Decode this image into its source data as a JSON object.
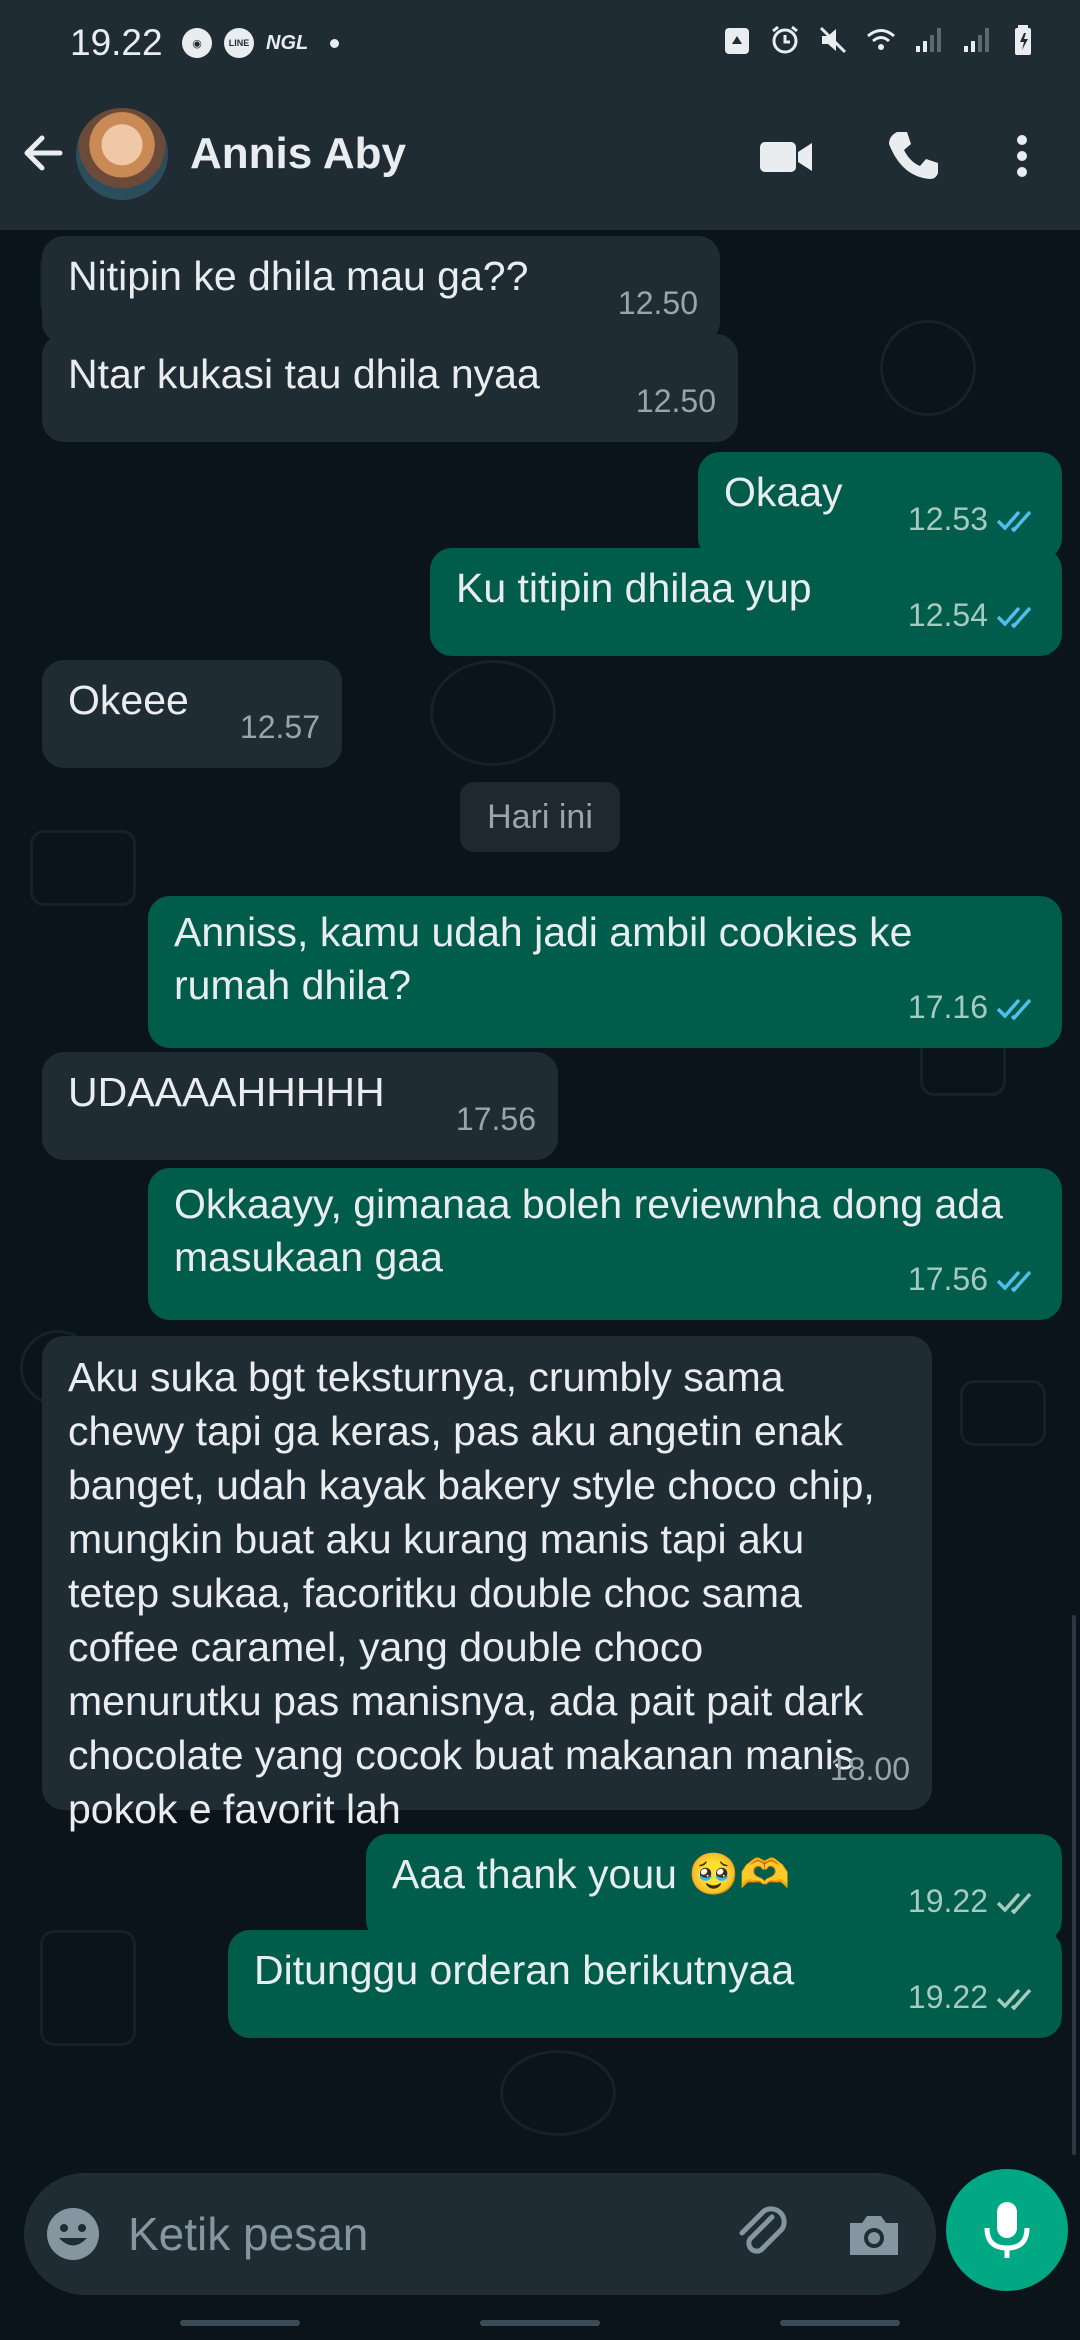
{
  "status_bar": {
    "time": "19.22",
    "left_icons": [
      "chrome-icon",
      "line-icon",
      "ngl-icon"
    ],
    "ngl_label": "NGL",
    "line_label": "LINE",
    "right_icons": [
      "recycle-icon",
      "alarm-icon",
      "mute-icon",
      "wifi-icon",
      "signal-icon",
      "signal-icon",
      "battery-icon"
    ]
  },
  "header": {
    "contact_name": "Annis Aby",
    "icons": [
      "back-arrow-icon",
      "video-call-icon",
      "voice-call-icon",
      "more-options-icon"
    ]
  },
  "date_separator": "Hari ini",
  "messages": [
    {
      "dir": "in",
      "text": "Nitipin ke dhila mau ga??",
      "time": "12.50"
    },
    {
      "dir": "in",
      "text": "Ntar kukasi tau dhila nyaa",
      "time": "12.50"
    },
    {
      "dir": "out",
      "text": "Okaay",
      "time": "12.53",
      "status": "read"
    },
    {
      "dir": "out",
      "text": "Ku titipin dhilaa yup",
      "time": "12.54",
      "status": "read"
    },
    {
      "dir": "in",
      "text": "Okeee",
      "time": "12.57"
    },
    {
      "dir": "out",
      "text": "Anniss, kamu udah jadi ambil cookies ke rumah dhila?",
      "time": "17.16",
      "status": "read"
    },
    {
      "dir": "in",
      "text": "UDAAAAHHHHH",
      "time": "17.56"
    },
    {
      "dir": "out",
      "text": "Okkaayy, gimanaa boleh reviewnha dong ada masukaan gaa",
      "time": "17.56",
      "status": "read"
    },
    {
      "dir": "in",
      "text": "Aku suka bgt teksturnya, crumbly sama chewy tapi ga keras, pas aku angetin enak banget, udah kayak bakery style choco chip, mungkin buat aku kurang manis tapi aku tetep sukaa, facoritku double choc sama coffee caramel, yang double choco menurutku pas manisnya, ada pait pait dark chocolate yang cocok buat makanan manis pokok e favorit lah",
      "time": "18.00"
    },
    {
      "dir": "out",
      "text": "Aaa thank youu 🥹🫶",
      "time": "19.22",
      "status": "delivered"
    },
    {
      "dir": "out",
      "text": "Ditunggu orderan berikutnyaa",
      "time": "19.22",
      "status": "delivered"
    }
  ],
  "composer": {
    "placeholder": "Ketik pesan",
    "icons": [
      "emoji-icon",
      "attach-icon",
      "camera-icon",
      "mic-icon"
    ]
  },
  "colors": {
    "bar_bg": "#1f2c34",
    "chat_bg": "#0b141a",
    "incoming_bubble": "#202c33",
    "outgoing_bubble": "#005c4b",
    "read_tick": "#53bdeb",
    "delivered_tick": "#a6c9c0",
    "mic_button": "#00a884"
  }
}
